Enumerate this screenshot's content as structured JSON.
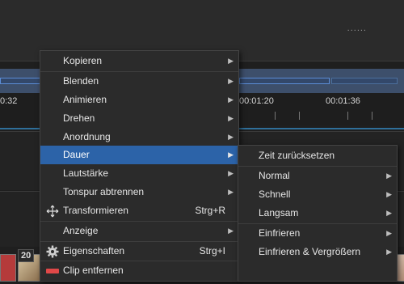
{
  "timeline": {
    "left_time": "0:32",
    "time_marks": [
      "00:01:20",
      "00:01:36"
    ],
    "thumb_labels": [
      "20",
      "20"
    ]
  },
  "context_menu": {
    "items": [
      {
        "label": "Kopieren",
        "has_submenu": true
      },
      {
        "label": "Blenden",
        "has_submenu": true
      },
      {
        "label": "Animieren",
        "has_submenu": true
      },
      {
        "label": "Drehen",
        "has_submenu": true
      },
      {
        "label": "Anordnung",
        "has_submenu": true
      },
      {
        "label": "Dauer",
        "has_submenu": true,
        "highlighted": true
      },
      {
        "label": "Lautstärke",
        "has_submenu": true
      },
      {
        "label": "Tonspur abtrennen",
        "has_submenu": true
      },
      {
        "label": "Transformieren",
        "shortcut": "Strg+R",
        "icon": "move-arrows-icon"
      },
      {
        "label": "Anzeige",
        "has_submenu": true
      },
      {
        "label": "Eigenschaften",
        "shortcut": "Strg+I",
        "icon": "gear-icon"
      },
      {
        "label": "Clip entfernen",
        "icon": "remove-clip-icon"
      }
    ]
  },
  "submenu_dauer": {
    "items": [
      {
        "label": "Zeit zurücksetzen"
      },
      {
        "label": "Normal",
        "has_submenu": true
      },
      {
        "label": "Schnell",
        "has_submenu": true
      },
      {
        "label": "Langsam",
        "has_submenu": true
      },
      {
        "label": "Einfrieren",
        "has_submenu": true
      },
      {
        "label": "Einfrieren & Vergrößern",
        "has_submenu": true
      }
    ]
  },
  "colors": {
    "highlight": "#2c63a8",
    "menu_bg": "#2b2b2b",
    "timeline_accent": "#3d4f6b",
    "remove_icon": "#e04848"
  }
}
